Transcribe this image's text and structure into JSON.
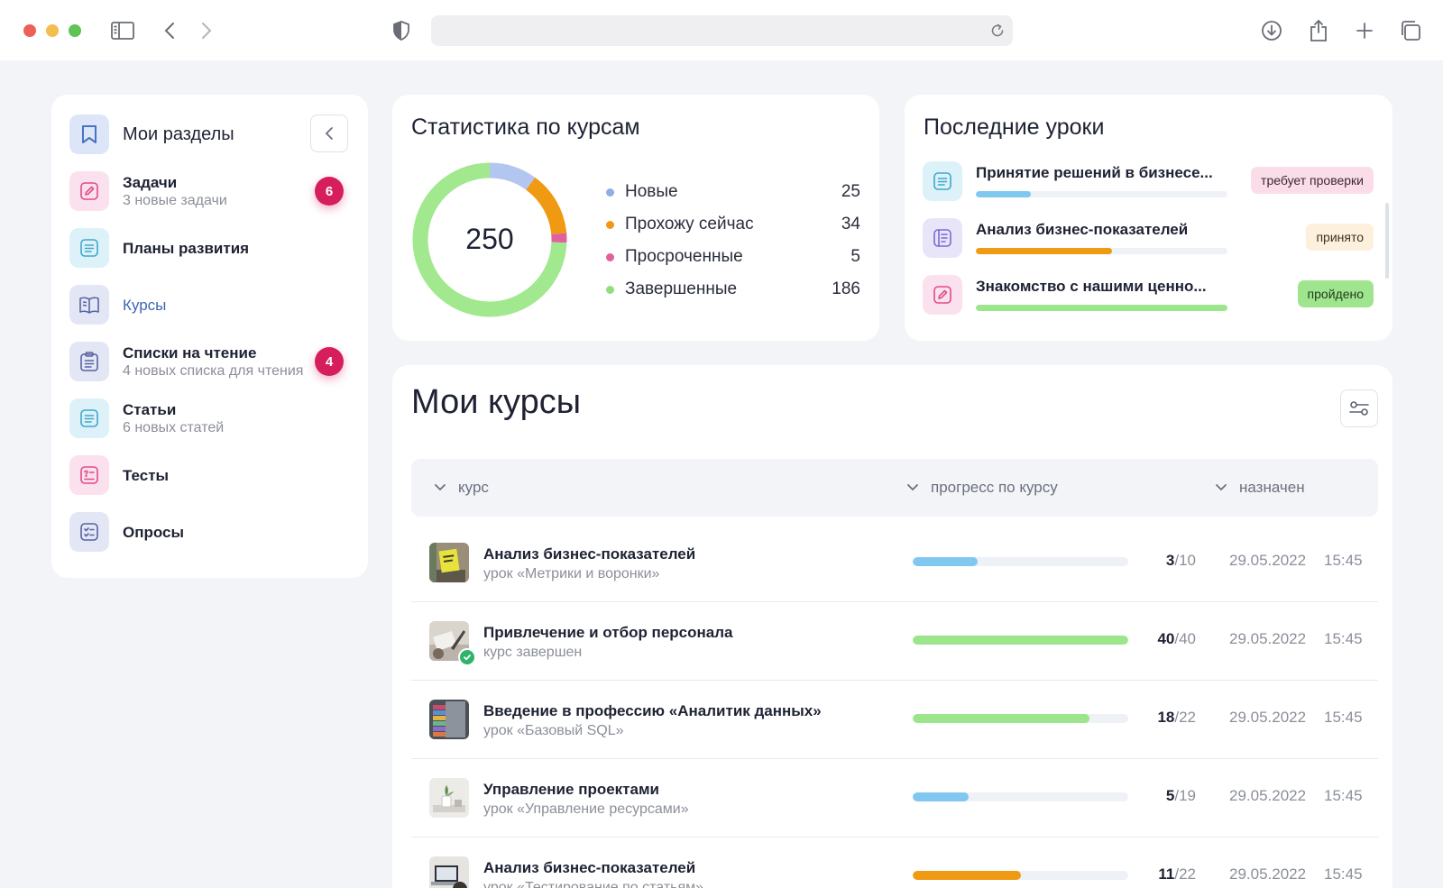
{
  "sidebar": {
    "title": "Мои разделы",
    "items": [
      {
        "label": "Задачи",
        "sub": "3 новые задачи",
        "badge": "6"
      },
      {
        "label": "Планы развития",
        "sub": ""
      },
      {
        "label": "Курсы",
        "sub": ""
      },
      {
        "label": "Списки на чтение",
        "sub": "4 новых списка для чтения",
        "badge": "4"
      },
      {
        "label": "Статьи",
        "sub": "6 новых статей"
      },
      {
        "label": "Тесты",
        "sub": ""
      },
      {
        "label": "Опросы",
        "sub": ""
      }
    ]
  },
  "stats": {
    "title": "Статистика по курсам",
    "total": "250",
    "legend": [
      {
        "label": "Новые",
        "value": "25"
      },
      {
        "label": "Прохожу сейчас",
        "value": "34"
      },
      {
        "label": "Просроченные",
        "value": "5"
      },
      {
        "label": "Завершенные",
        "value": "186"
      }
    ]
  },
  "chart_data": {
    "type": "pie",
    "categories": [
      "Новые",
      "Прохожу сейчас",
      "Просроченные",
      "Завершенные"
    ],
    "values": [
      25,
      34,
      5,
      186
    ],
    "title": "Статистика по курсам",
    "center_label": "250",
    "colors": [
      "#b3c6ef",
      "#ef9a12",
      "#e1609d",
      "#a1e88f"
    ]
  },
  "lessons": {
    "title": "Последние уроки",
    "items": [
      {
        "title": "Принятие решений в бизнесе...",
        "progress": 0.22,
        "status": "требует проверки"
      },
      {
        "title": "Анализ бизнес-показателей",
        "progress": 0.54,
        "status": "принято"
      },
      {
        "title": "Знакомство с нашими ценно...",
        "progress": 1.0,
        "status": "пройдено"
      }
    ]
  },
  "courses": {
    "title": "Мои курсы",
    "columns": {
      "course": "курс",
      "progress": "прогресс по курсу",
      "assigned": "назначен"
    },
    "rows": [
      {
        "title": "Анализ бизнес-показателей",
        "sub": "урок «Метрики и воронки»",
        "done": "3",
        "total": "/10",
        "progress": 0.3,
        "color": "#80c8f0",
        "date": "29.05.2022",
        "time": "15:45",
        "completed": false
      },
      {
        "title": "Привлечение и отбор персонала",
        "sub": "курс завершен",
        "done": "40",
        "total": "/40",
        "progress": 1.0,
        "color": "#9be58a",
        "date": "29.05.2022",
        "time": "15:45",
        "completed": true
      },
      {
        "title": "Введение в профессию «Аналитик данных»",
        "sub": "урок «Базовый SQL»",
        "done": "18",
        "total": "/22",
        "progress": 0.82,
        "color": "#9be58a",
        "date": "29.05.2022",
        "time": "15:45",
        "completed": false
      },
      {
        "title": "Управление проектами",
        "sub": "урок «Управление ресурсами»",
        "done": "5",
        "total": "/19",
        "progress": 0.26,
        "color": "#80c8f0",
        "date": "29.05.2022",
        "time": "15:45",
        "completed": false
      },
      {
        "title": "Анализ бизнес-показателей",
        "sub": "урок «Тестирование по статьям»",
        "done": "11",
        "total": "/22",
        "progress": 0.5,
        "color": "#ef9a12",
        "date": "29.05.2022",
        "time": "15:45",
        "completed": false
      }
    ]
  },
  "colors": {
    "accent": "#3d66b3",
    "badge": "#d61e5d",
    "background": "#f3f4f8"
  }
}
